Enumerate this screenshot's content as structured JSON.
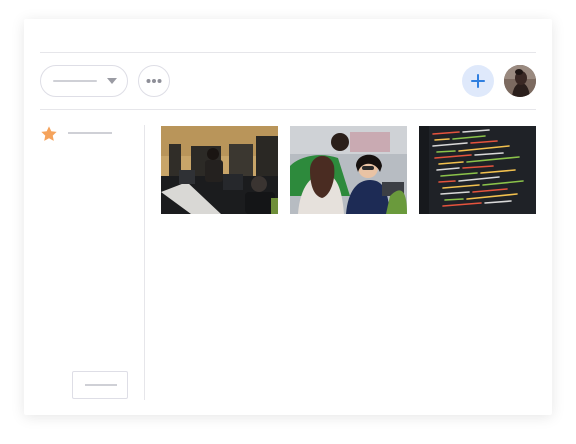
{
  "toolbar": {
    "select_icon": "chevron-down-icon",
    "more_icon": "more-horizontal-icon",
    "add_icon": "plus-icon"
  },
  "sidebar": {
    "favorite_icon": "star-icon"
  },
  "gallery": {
    "photos": [
      {
        "subject": "office-workers-photo"
      },
      {
        "subject": "team-laptop-photo"
      },
      {
        "subject": "code-screen-photo"
      }
    ]
  },
  "colors": {
    "accent": "#2f7fe0",
    "accent_bg": "#dfe9fb",
    "star": "#f5a35c",
    "border": "#dedee6",
    "placeholder_line": "#cfd0d6"
  }
}
